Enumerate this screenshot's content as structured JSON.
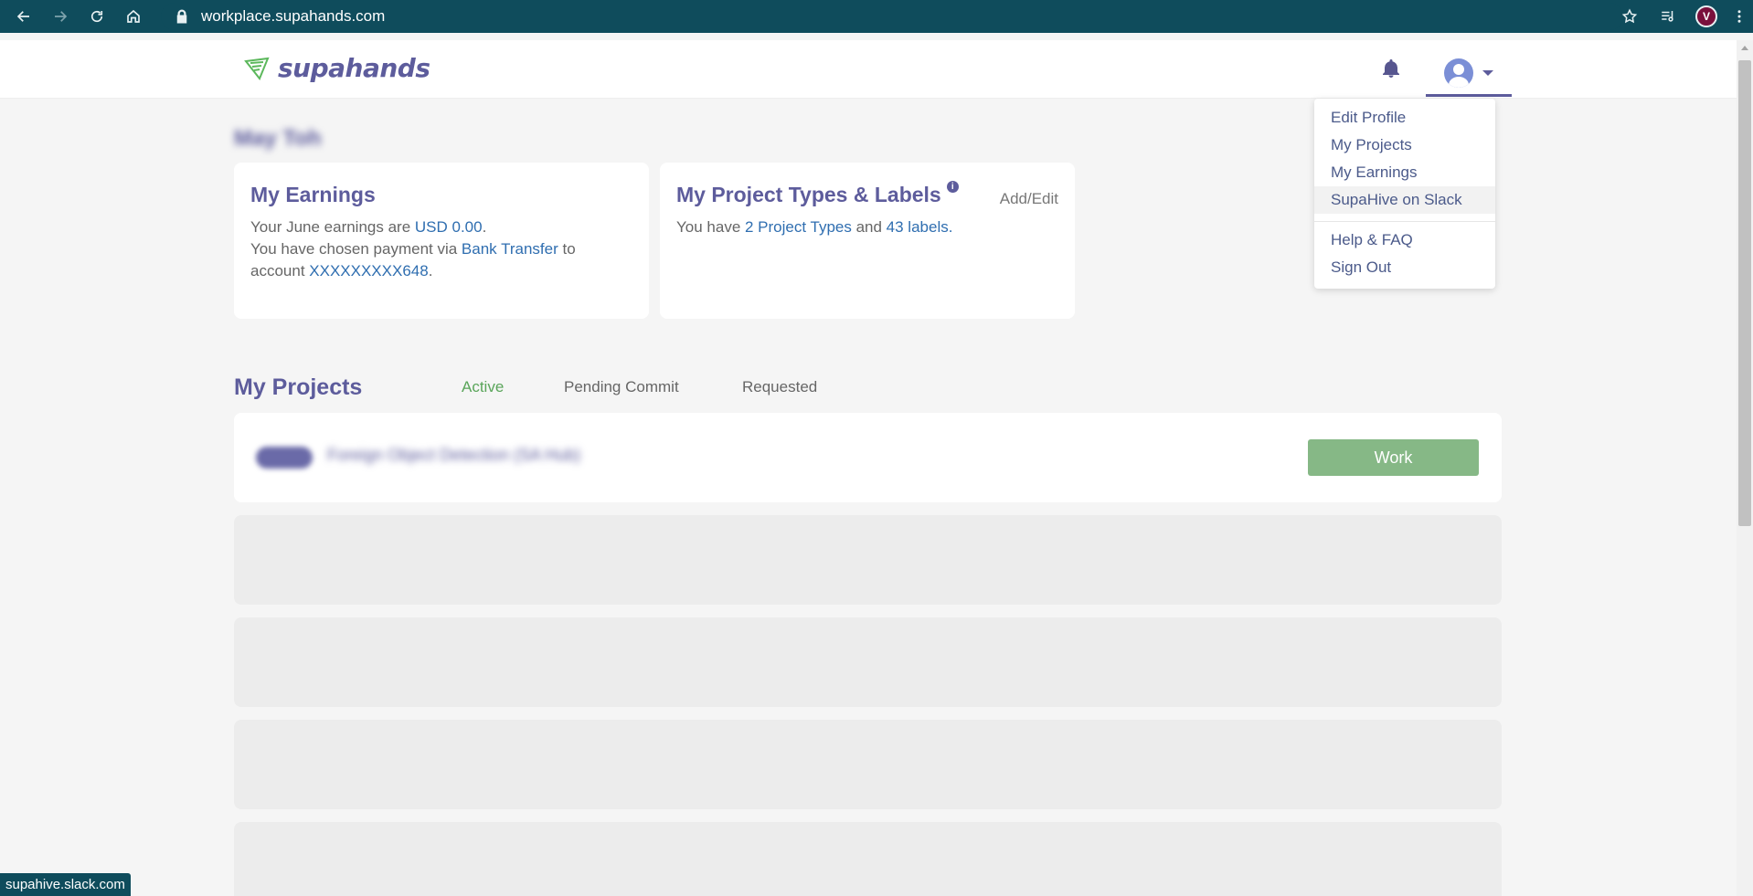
{
  "browser": {
    "url": "workplace.supahands.com",
    "status_url": "supahive.slack.com",
    "avatar_letter": "V"
  },
  "header": {
    "logo_text": "supahands"
  },
  "user_menu": {
    "items": [
      {
        "label": "Edit Profile"
      },
      {
        "label": "My Projects"
      },
      {
        "label": "My Earnings"
      },
      {
        "label": "SupaHive on Slack"
      }
    ],
    "secondary_items": [
      {
        "label": "Help & FAQ"
      },
      {
        "label": "Sign Out"
      }
    ]
  },
  "greeting": "May Toh",
  "earnings": {
    "title": "My Earnings",
    "line1_prefix": "Your June earnings are ",
    "amount": "USD 0.00",
    "line1_suffix": ".",
    "line2_prefix": "You have chosen payment via ",
    "method": "Bank Transfer",
    "line2_suffix": " to",
    "line3_prefix": "account ",
    "account": "XXXXXXXXX648",
    "line3_suffix": "."
  },
  "project_types": {
    "title": "My Project Types & Labels",
    "info": "i",
    "add_edit": "Add/Edit",
    "prefix": "You have ",
    "types_link": "2 Project Types",
    "middle": " and ",
    "labels_link": "43 labels",
    "suffix": "."
  },
  "projects": {
    "title": "My Projects",
    "tabs": [
      {
        "label": "Active"
      },
      {
        "label": "Pending Commit"
      },
      {
        "label": "Requested"
      }
    ],
    "rows": [
      {
        "tag": "NEW",
        "name": "Foreign Object Detection (SA Hub)",
        "action": "Work"
      }
    ]
  }
}
